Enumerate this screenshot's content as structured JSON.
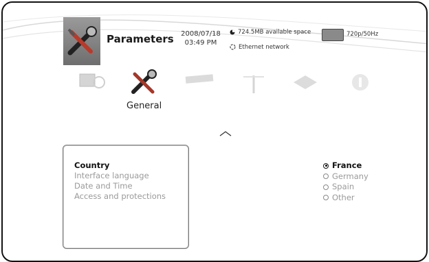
{
  "header": {
    "title": "Parameters",
    "date": "2008/07/18",
    "time": "03:49 PM",
    "space": "724.5MB available space",
    "network": "Ethernet network",
    "video_mode": "720p/50Hz"
  },
  "categories": [
    {
      "icon": "display-settings-icon",
      "active": false
    },
    {
      "icon": "tools-icon",
      "active": true
    },
    {
      "icon": "remote-control-icon",
      "active": false
    },
    {
      "icon": "antenna-icon",
      "active": false
    },
    {
      "icon": "circuit-board-icon",
      "active": false
    },
    {
      "icon": "info-icon",
      "active": false
    }
  ],
  "active_category_label": "General",
  "menu": {
    "items": [
      "Country",
      "Interface language",
      "Date and Time",
      "Access and protections"
    ],
    "selected_index": 0
  },
  "options": {
    "items": [
      "France",
      "Germany",
      "Spain",
      "Other"
    ],
    "selected_index": 0
  }
}
